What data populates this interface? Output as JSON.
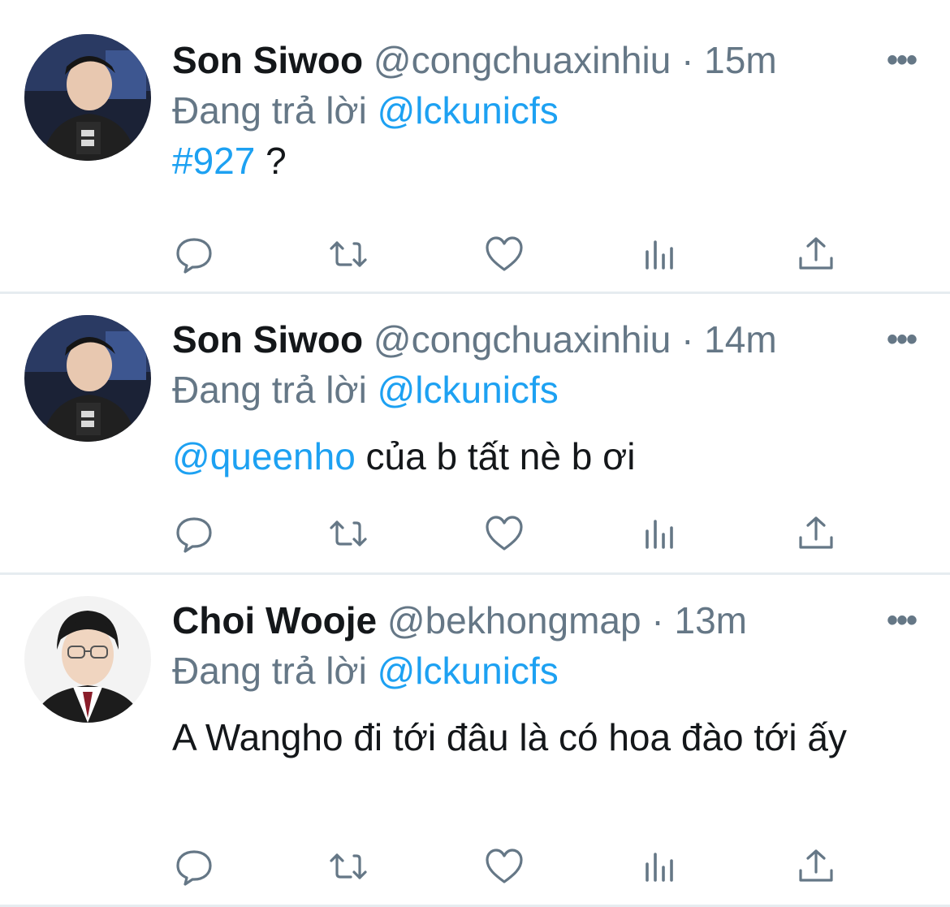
{
  "tweets": [
    {
      "name": "Son Siwoo",
      "handle": "@congchuaxinhiu",
      "dot": "·",
      "time": "15m",
      "more": "•••",
      "replying_prefix": "Đang trả lời",
      "replying_to": "@lckunicfs",
      "body_link": "#927",
      "body_text": " ?",
      "avatar": "avatar-photo-player-dark-jacket"
    },
    {
      "name": "Son Siwoo",
      "handle": "@congchuaxinhiu",
      "dot": "·",
      "time": "14m",
      "more": "•••",
      "replying_prefix": "Đang trả lời",
      "replying_to": "@lckunicfs",
      "body_link": "@queenho",
      "body_text": " của b tất nè b ơi",
      "avatar": "avatar-photo-player-dark-jacket"
    },
    {
      "name": "Choi Wooje",
      "handle": "@bekhongmap",
      "dot": "·",
      "time": "13m",
      "more": "•••",
      "replying_prefix": "Đang trả lời",
      "replying_to": "@lckunicfs",
      "body_link": "",
      "body_text": "A Wangho đi tới đâu là có hoa đào tới ấy",
      "avatar": "avatar-photo-player-glasses-uniform"
    }
  ],
  "actions": [
    "reply-icon",
    "retweet-icon",
    "like-icon",
    "analytics-icon",
    "share-icon"
  ],
  "colors": {
    "link": "#1da1f2",
    "secondary_text": "#657786",
    "icon": "#657786",
    "divider": "#e6ecf0"
  }
}
